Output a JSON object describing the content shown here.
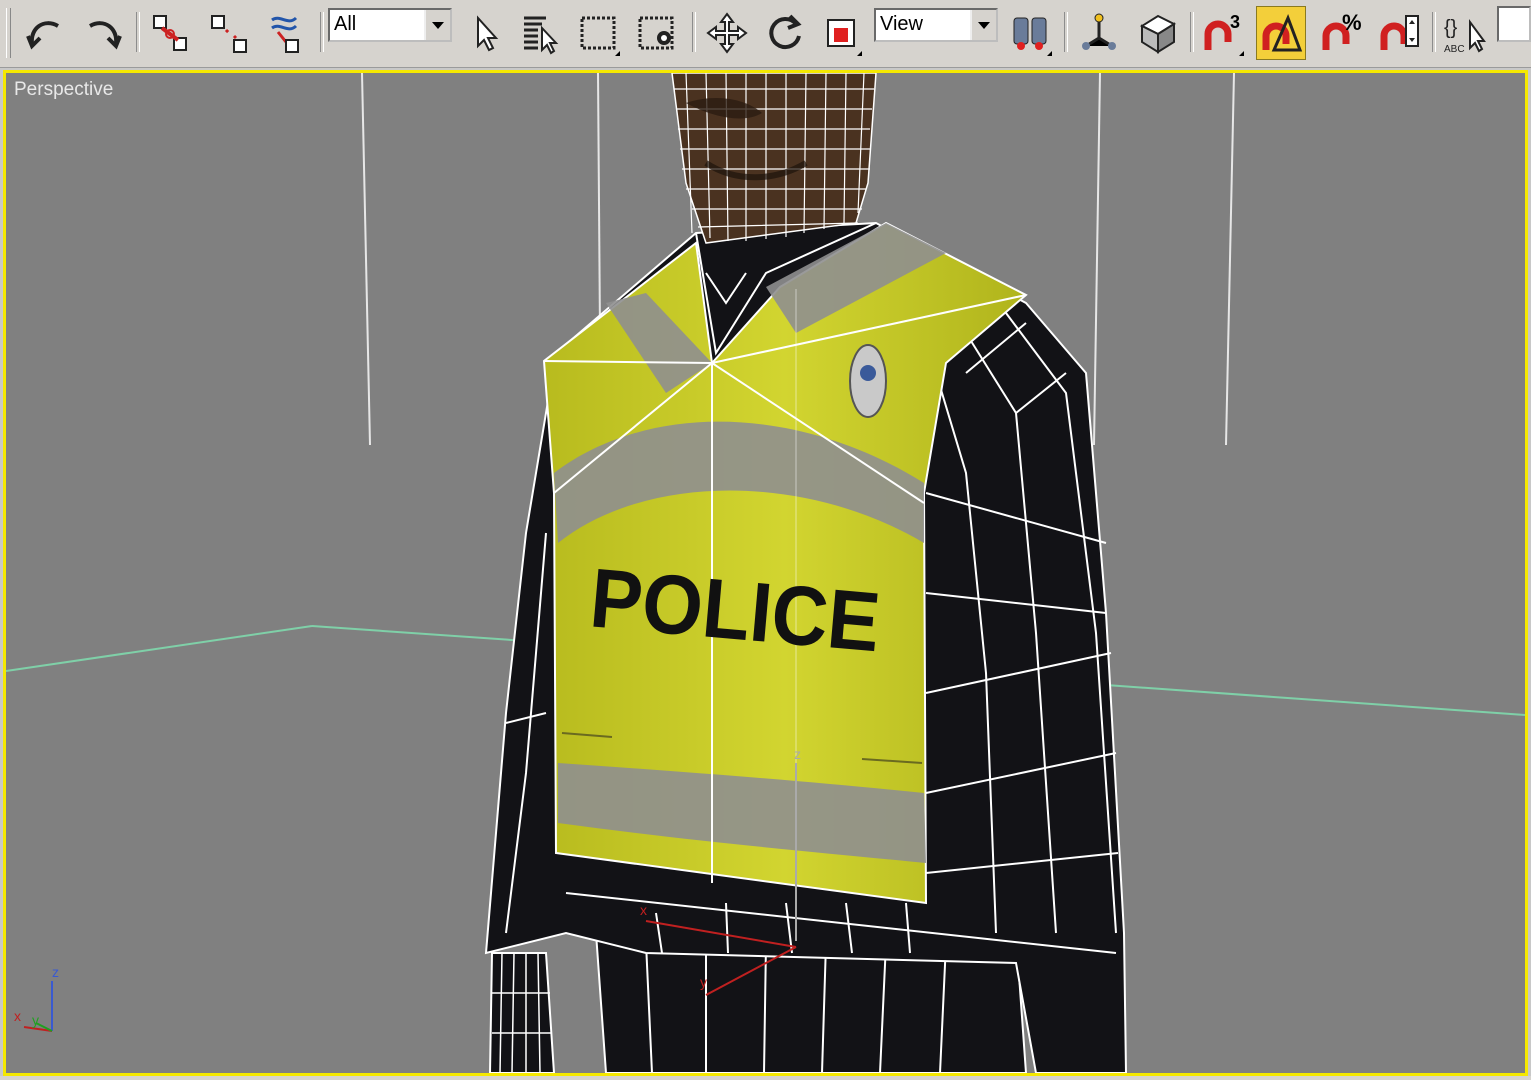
{
  "toolbar": {
    "buttons": [
      {
        "name": "undo",
        "icon": "undo-icon"
      },
      {
        "name": "redo",
        "icon": "redo-icon"
      },
      {
        "name": "select-and-link",
        "icon": "link-icon"
      },
      {
        "name": "unlink-selection",
        "icon": "unlink-icon"
      },
      {
        "name": "bind-to-space-warp",
        "icon": "space-warp-icon"
      },
      {
        "name": "select-object",
        "icon": "arrow-cursor-icon"
      },
      {
        "name": "select-by-name",
        "icon": "select-by-name-icon"
      },
      {
        "name": "rectangular-selection-region",
        "icon": "rect-selection-icon"
      },
      {
        "name": "window-crossing",
        "icon": "window-crossing-icon"
      },
      {
        "name": "select-and-move",
        "icon": "move-icon"
      },
      {
        "name": "select-and-rotate",
        "icon": "rotate-icon"
      },
      {
        "name": "select-and-scale",
        "icon": "scale-icon"
      },
      {
        "name": "use-pivot-point-center",
        "icon": "pivot-center-icon"
      },
      {
        "name": "select-and-manipulate",
        "icon": "manipulate-icon"
      },
      {
        "name": "keyboard-shortcut-override",
        "icon": "keyboard-override-icon"
      },
      {
        "name": "snaps-toggle",
        "icon": "snap-3d-icon"
      },
      {
        "name": "angle-snap-toggle",
        "icon": "angle-snap-icon"
      },
      {
        "name": "percent-snap-toggle",
        "icon": "percent-snap-icon"
      },
      {
        "name": "spinner-snap-toggle",
        "icon": "spinner-snap-icon"
      },
      {
        "name": "edit-named-selection-sets",
        "icon": "named-selection-icon"
      }
    ],
    "selection_filter": "All",
    "reference_coord_system": "View",
    "snap_label": "3",
    "percent_label": "%",
    "named_sel_label": "ABC",
    "braces_label": "{}",
    "active_color": "#f3cf3a"
  },
  "viewport": {
    "label": "Perspective",
    "border_color": "#f5e800",
    "background": "#808080",
    "axis_labels": {
      "x": "x",
      "y": "y",
      "z": "z"
    },
    "gizmo_labels": {
      "x": "x",
      "y": "y",
      "z": "z"
    },
    "vest_text": "POLICE",
    "vest_color": "#c9cc28",
    "reflective_color": "#8f8f8f",
    "uniform_color": "#121216",
    "grid_color": "#7fd0a8"
  }
}
